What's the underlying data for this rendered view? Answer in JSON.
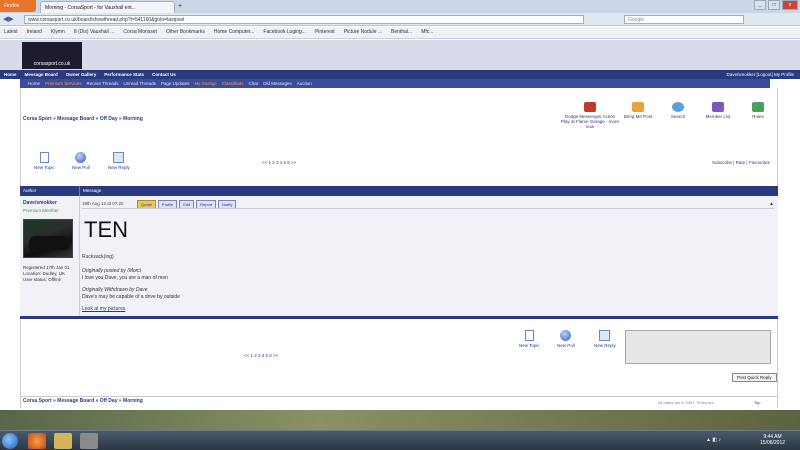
{
  "browser": {
    "app_button": "Firefox",
    "tab_title": "Morning - CorsaSport - for Vauxhall ent...",
    "url": "www.corsasport.co.uk/board/showthread.php?t=541160&goto=lastpost",
    "search_placeholder": "Google",
    "bookmarks": [
      "Latest",
      "Ireland",
      "Klymn",
      "8 (Dis) Vauxhall ...",
      "Corsa Monsset",
      "Other Bookmarks",
      "Home Computer...",
      "Facebook Loging...",
      "Pinterest",
      "Picture Nodule ...",
      "Benthal...",
      "Mfc..."
    ]
  },
  "site": {
    "logo_text": "corsasport.co.uk",
    "topnav": [
      "Home",
      "Message Board",
      "Owner Gallery",
      "Performance Stats",
      "Contact Us"
    ],
    "topnav_right": "Dave/smokker [Logout] My Profile",
    "subnav": [
      "Home",
      "Premium Services",
      "Recent Threads",
      "Unread Threads",
      "Page Updates",
      "My Garage",
      "Classifieds",
      "Chat",
      "Old Messages",
      "Auction"
    ],
    "breadcrumb": "Corsa Sport » Message Board » Off Day » Morning",
    "quick_icons": [
      {
        "label": "Dodge Messenger Action Play at Flame Garage - more now",
        "icon": "promo-icon"
      },
      {
        "label": "Bring Me Post",
        "icon": "bring-icon"
      },
      {
        "label": "Search",
        "icon": "search-icon"
      },
      {
        "label": "Member List",
        "icon": "members-icon"
      },
      {
        "label": "Rules",
        "icon": "rules-icon"
      }
    ]
  },
  "thread": {
    "actions_top": [
      "New Topic",
      "New Poll",
      "New Reply"
    ],
    "pager_top": "<< 1 2 3 4 5 6 >>",
    "subscribe": "Subscribe | Rate | Favourites",
    "table_header": {
      "author": "Author",
      "message": "Message"
    },
    "post": {
      "author": "Dave/smokker",
      "rank": "Premium Member",
      "user_info": [
        "Registered 17th Jan 01",
        "Location: Dudley, UK",
        "User status: Offline"
      ],
      "posted": "19th Aug 12 at 07:20",
      "buttons": [
        "Quote",
        "Profile",
        "Edit",
        "Report",
        "Notify"
      ],
      "big_text": "TEN",
      "lines": [
        {
          "text": "Rucksack(ing)",
          "style": "normal"
        },
        {
          "text": "Originally posted by /Morci",
          "style": "ital"
        },
        {
          "text": "I love you Dave, you are a man of men",
          "style": "normal"
        },
        {
          "text": "Originally Withdrawn by Dave",
          "style": "ital"
        },
        {
          "text": "Dave's may be capable of a drive by outside",
          "style": "normal"
        },
        {
          "text": "Look at my pictures",
          "style": "link"
        }
      ]
    },
    "actions_bottom": [
      "New Topic",
      "New Poll",
      "New Reply"
    ],
    "pager_bottom": "<< 1 2 3 4 5 6 >>",
    "post_reply_btn": "Post Quick Reply",
    "footer_breadcrumb": "Corsa Sport » Message Board » Off Day » Morning",
    "footer_right": "All dates are in GMT. Times are",
    "footer_right2": "Top"
  },
  "taskbar": {
    "time": "9:44 AM",
    "date": "15/08/2012"
  }
}
